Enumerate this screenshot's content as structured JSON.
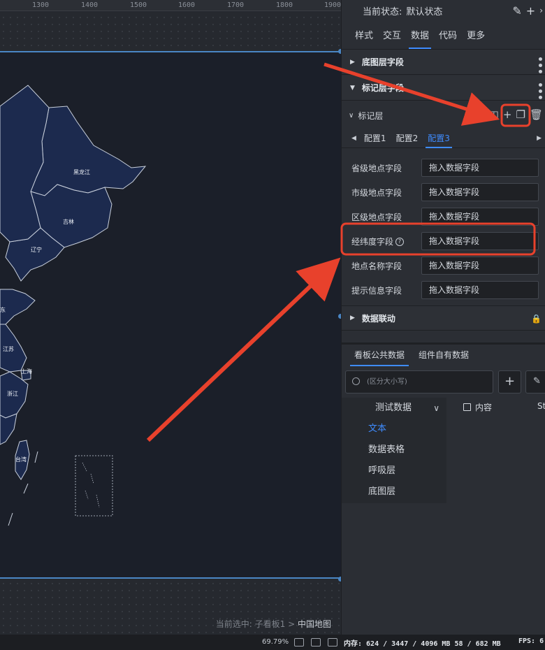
{
  "ruler": {
    "ticks": [
      "1300",
      "1400",
      "1500",
      "1600",
      "1700",
      "1800",
      "1900"
    ]
  },
  "map": {
    "provinces": [
      "黑龙江",
      "吉林",
      "辽宁",
      "东",
      "江苏",
      "上海",
      "浙江",
      "台湾"
    ],
    "colors": {
      "fill": "#1c2a4e",
      "border": "#c9d0dc",
      "board": "#1b1f29"
    }
  },
  "breadcrumb": {
    "prefix": "当前选中: 子看板1 >",
    "current": "中国地图"
  },
  "state_bar": {
    "label": "当前状态:",
    "value": "默认状态",
    "edit_icon": "edit-icon",
    "add_icon": "plus-icon",
    "more_icon": "chevron-right-icon"
  },
  "tabs": [
    "样式",
    "交互",
    "数据",
    "代码",
    "更多"
  ],
  "active_tab": "数据",
  "sections": {
    "base_layer": "底图层字段",
    "marker_layer": "标记层字段",
    "data_link": "数据联动"
  },
  "layer": {
    "name": "标记层",
    "tools": [
      "table-icon",
      "layout-icon",
      "plus-icon",
      "copy-icon",
      "trash-icon"
    ]
  },
  "configs": [
    "配置1",
    "配置2",
    "配置3"
  ],
  "active_config": "配置3",
  "fields": [
    {
      "label": "省级地点字段",
      "placeholder": "拖入数据字段"
    },
    {
      "label": "市级地点字段",
      "placeholder": "拖入数据字段"
    },
    {
      "label": "区级地点字段",
      "placeholder": "拖入数据字段"
    },
    {
      "label": "经纬度字段",
      "placeholder": "拖入数据字段",
      "help": "?"
    },
    {
      "label": "地点名称字段",
      "placeholder": "拖入数据字段"
    },
    {
      "label": "提示信息字段",
      "placeholder": "拖入数据字段"
    }
  ],
  "bottom_tabs": [
    "看板公共数据",
    "组件自有数据"
  ],
  "search": {
    "placeholder": "(区分大小写)"
  },
  "datasets": {
    "group": "测试数据",
    "items": [
      "文本",
      "数据表格",
      "呼吸层",
      "底图层"
    ],
    "active": "文本"
  },
  "columns": {
    "content": "内容",
    "partial": "St"
  },
  "status_bar": {
    "zoom": "69.79%",
    "memory": "内存: 624 / 3447 / 4096 MB  58 / 682 MB",
    "fps": "FPS: 6"
  },
  "annotation_color": "#e8412c"
}
